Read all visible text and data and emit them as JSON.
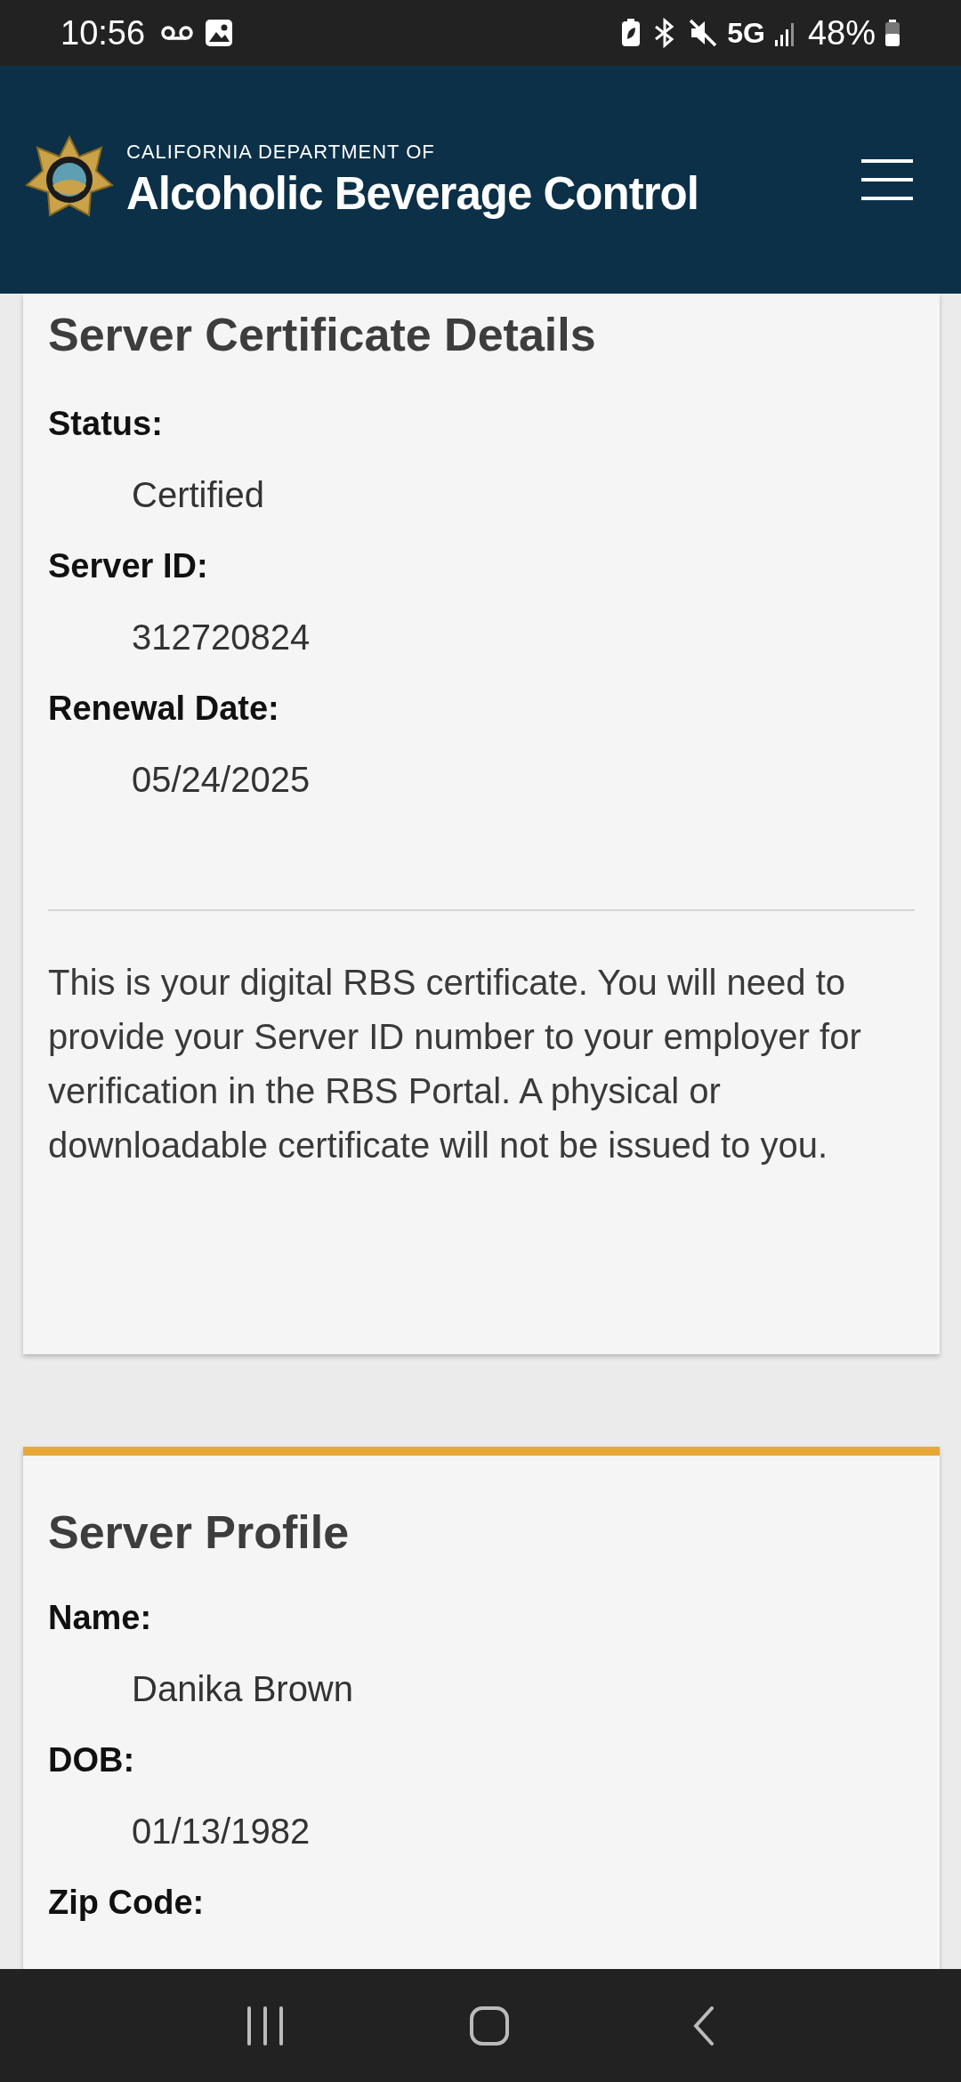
{
  "status_bar": {
    "time": "10:56",
    "network": "5G",
    "battery": "48%"
  },
  "header": {
    "department": "CALIFORNIA DEPARTMENT OF",
    "title": "Alcoholic Beverage Control"
  },
  "certificate": {
    "title": "Server Certificate Details",
    "fields": [
      {
        "label": "Status:",
        "value": "Certified"
      },
      {
        "label": "Server ID:",
        "value": "312720824"
      },
      {
        "label": "Renewal Date:",
        "value": "05/24/2025"
      }
    ],
    "note": "This is your digital RBS certificate. You will need to provide your Server ID number to your employer for verification in the RBS Portal. A physical or downloadable certificate will not be issued to you."
  },
  "profile": {
    "title": "Server Profile",
    "fields": [
      {
        "label": "Name:",
        "value": "Danika Brown"
      },
      {
        "label": "DOB:",
        "value": "01/13/1982"
      },
      {
        "label": "Zip Code:"
      }
    ]
  }
}
